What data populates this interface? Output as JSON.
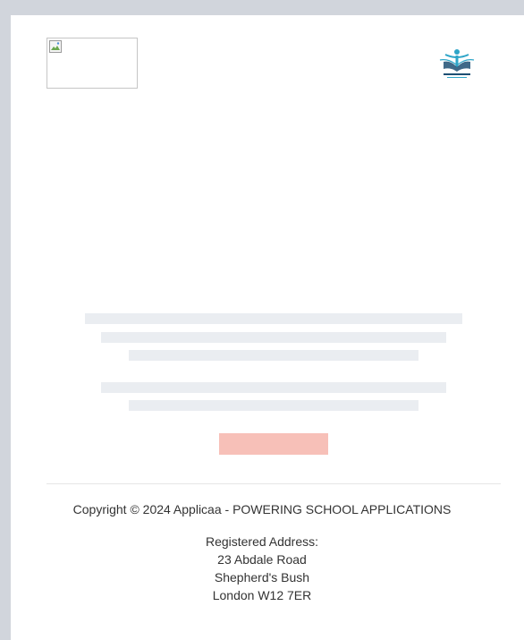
{
  "footer": {
    "copyright": "Copyright © 2024 Applicaa - POWERING SCHOOL APPLICATIONS",
    "address_label": "Registered Address:",
    "address_line1": "23 Abdale Road",
    "address_line2": "Shepherd's Bush",
    "address_line3": "London W12 7ER"
  },
  "logo": {
    "icon": "education-book-logo-icon",
    "accent_color": "#2ea5c8",
    "dark_color": "#1d4f73"
  },
  "placeholder": {
    "icon": "broken-image-icon"
  },
  "skeleton": {
    "text_color": "#eaedf1",
    "button_color": "#f7c0b8"
  }
}
